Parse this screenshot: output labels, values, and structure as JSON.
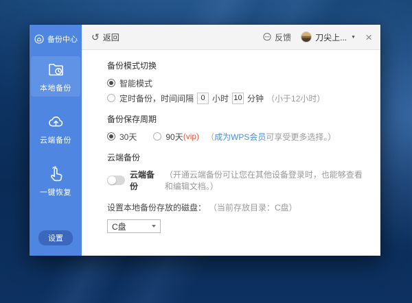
{
  "window": {
    "sidebar": {
      "header": {
        "label": "备份中心"
      },
      "items": [
        {
          "label": "本地备份",
          "active": true
        },
        {
          "label": "云端备份",
          "active": false
        },
        {
          "label": "一键恢复",
          "active": false
        }
      ],
      "settings_label": "设置"
    },
    "topbar": {
      "back_label": "返回",
      "feedback_label": "反馈",
      "username": "刀尖上..."
    },
    "sections": {
      "backup_mode": {
        "title": "备份模式切换",
        "smart_label": "智能模式",
        "timed_label": "定时备份，时间间隔",
        "hours_value": "0",
        "hours_unit": "小时",
        "minutes_value": "10",
        "minutes_unit": "分钟",
        "timed_note": "（小于12小时）"
      },
      "retention": {
        "title": "备份保存周期",
        "option_30": "30天",
        "option_90": "90天",
        "vip_tag": "(vip)",
        "note_open": "（ ",
        "vip_link": "成为WPS会员",
        "note_rest": " 可享受更多选择。）"
      },
      "cloud": {
        "title": "云端备份",
        "toggle_label": "云端备份",
        "note": "（开通云端备份可让您在其他设备登录时，也能够查看和编辑文档。）"
      },
      "disk": {
        "label": "设置本地备份存放的磁盘：",
        "note": "（当前存放目录：C盘）",
        "selected_value": "C盘"
      }
    }
  },
  "icons": {
    "back_glyph": "↺",
    "caret_glyph": "▼",
    "close_glyph": "×"
  },
  "colors": {
    "sidebar_blue": "#4e86e2",
    "settings_pill_blue": "#3b67bd",
    "link_blue": "#4a90d9",
    "vip_orange": "#e25a3c",
    "topbar_gray": "#f4f4f4"
  }
}
